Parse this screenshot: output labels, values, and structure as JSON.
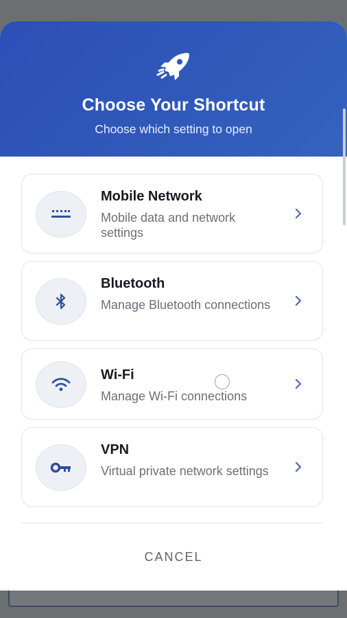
{
  "header": {
    "title": "Choose Your Shortcut",
    "subtitle": "Choose which setting to open",
    "icon": "rocket-icon",
    "gradient_start": "#2d4fb8",
    "gradient_end": "#3563be"
  },
  "shortcuts": [
    {
      "title": "Mobile Network",
      "description": "Mobile data and network settings",
      "icon": "mobile-network-icon"
    },
    {
      "title": "Bluetooth",
      "description": "Manage Bluetooth connections",
      "icon": "bluetooth-icon"
    },
    {
      "title": "Wi-Fi",
      "description": "Manage Wi-Fi connections",
      "icon": "wifi-icon"
    },
    {
      "title": "VPN",
      "description": "Virtual private network settings",
      "icon": "key-icon"
    }
  ],
  "footer": {
    "cancel_label": "CANCEL"
  },
  "colors": {
    "accent": "#2f57b9",
    "icon_color": "#2f4f9e",
    "chevron_color": "#4f6aa8"
  }
}
